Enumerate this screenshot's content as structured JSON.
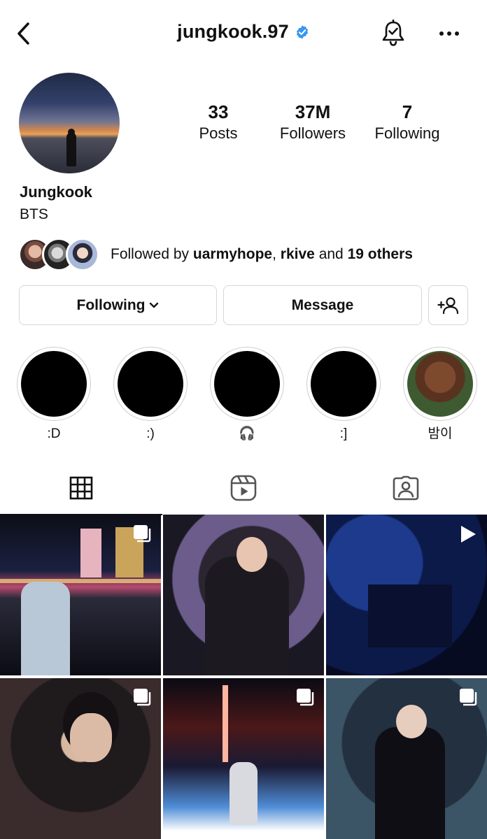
{
  "header": {
    "username": "jungkook.97",
    "verified": true,
    "icons": {
      "back": "chevron-left-icon",
      "bell": "bell-check-icon",
      "more": "more-horizontal-icon"
    }
  },
  "profile": {
    "name": "Jungkook",
    "bio": "BTS",
    "stats": [
      {
        "value": "33",
        "label": "Posts"
      },
      {
        "value": "37M",
        "label": "Followers"
      },
      {
        "value": "7",
        "label": "Following"
      }
    ]
  },
  "followed_by": {
    "prefix": "Followed by",
    "user1": "uarmyhope",
    "sep": ",",
    "user2": "rkive",
    "and": "and",
    "others": "19 others"
  },
  "actions": {
    "following": "Following",
    "message": "Message"
  },
  "highlights": [
    {
      "label": ":D"
    },
    {
      "label": ":)"
    },
    {
      "label": "🎧"
    },
    {
      "label": ":]"
    },
    {
      "label": "밤이"
    }
  ],
  "tabs": [
    {
      "name": "posts-grid-tab",
      "icon": "grid-icon",
      "active": true
    },
    {
      "name": "reels-tab",
      "icon": "reels-icon",
      "active": false
    },
    {
      "name": "tagged-tab",
      "icon": "tagged-person-icon",
      "active": false
    }
  ],
  "colors": {
    "verified_blue": "#3897f0",
    "border": "#d6d6d6",
    "text": "#111111"
  }
}
